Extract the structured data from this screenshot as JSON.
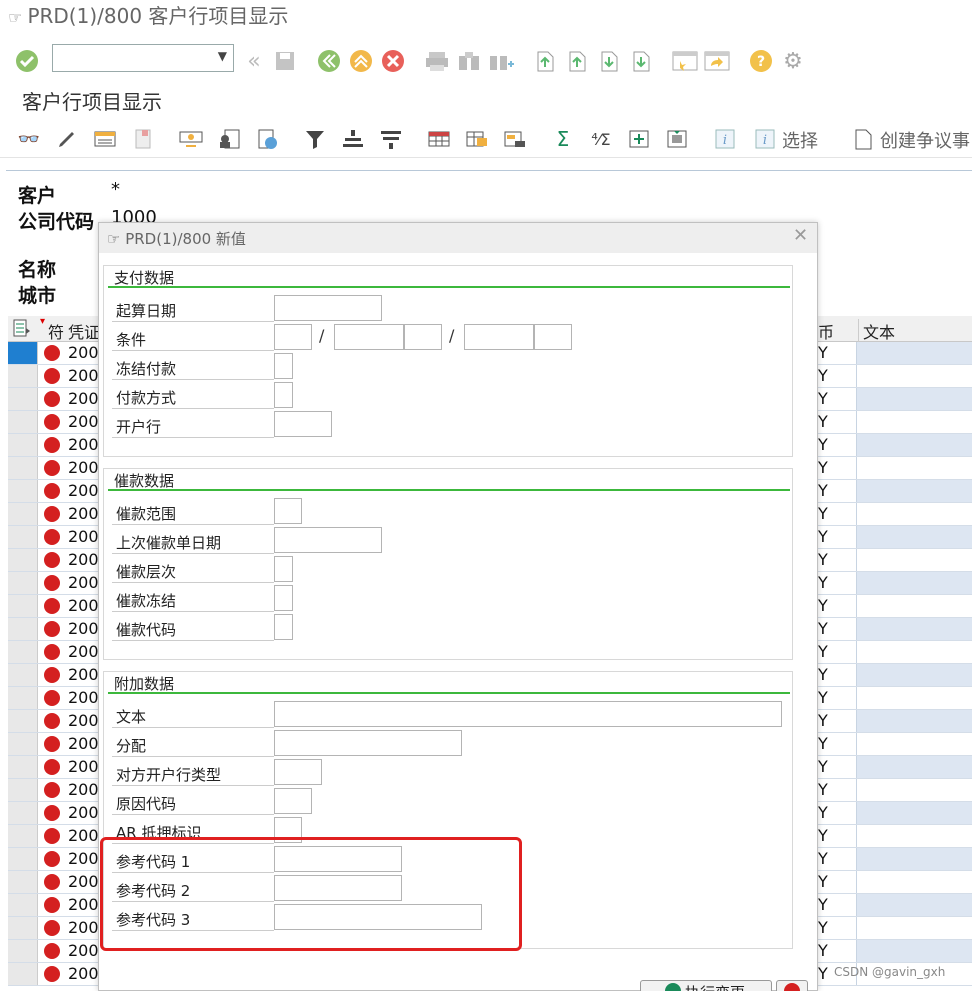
{
  "window": {
    "title": "PRD(1)/800 客户行项目显示"
  },
  "screen_title": "客户行项目显示",
  "toolbar2": {
    "select_label": "选择",
    "dispute_label": "创建争议事"
  },
  "header": {
    "customer_label": "客户",
    "customer_value": "*",
    "company_code_label": "公司代码",
    "company_code_value": "1000",
    "name_label": "名称",
    "city_label": "城市"
  },
  "grid": {
    "col_symbol": "符",
    "col_doc": "凭证",
    "col_currency": "币",
    "col_text": "文本",
    "row_number": "200",
    "row_currency": "Y",
    "row_count": 28
  },
  "dialog": {
    "title": "PRD(1)/800 新值",
    "payment": {
      "title": "支付数据",
      "baseline_date": "起算日期",
      "terms": "条件",
      "payment_block": "冻结付款",
      "payment_method": "付款方式",
      "bank": "开户行"
    },
    "dunning": {
      "title": "催款数据",
      "area": "催款范围",
      "last_dunned": "上次催款单日期",
      "level": "催款层次",
      "block": "催款冻结",
      "key": "催款代码"
    },
    "additional": {
      "title": "附加数据",
      "text": "文本",
      "assignment": "分配",
      "partner_bank_type": "对方开户行类型",
      "reason_code": "原因代码",
      "ar_pledging": "AR 抵押标识",
      "ref_key1": "参考代码 1",
      "ref_key2": "参考代码 2",
      "ref_key3": "参考代码 3"
    },
    "execute_label": "执行变更"
  },
  "watermark": "CSDN @gavin_gxh"
}
